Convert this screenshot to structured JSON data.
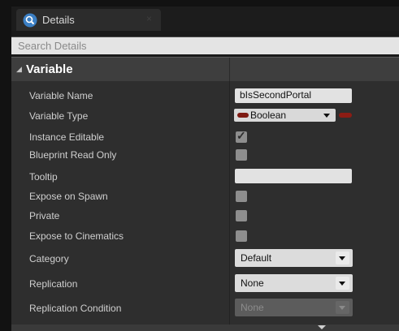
{
  "tab": {
    "title": "Details",
    "icon": "details-magnifier-icon",
    "close_icon": "close-icon"
  },
  "search": {
    "placeholder": "Search Details",
    "value": ""
  },
  "section": {
    "title": "Variable",
    "expanded": true
  },
  "properties": {
    "variable_name": {
      "label": "Variable Name",
      "value": "bIsSecondPortal"
    },
    "variable_type": {
      "label": "Variable Type",
      "value": "Boolean",
      "pin_color": "#8c1c14"
    },
    "instance_editable": {
      "label": "Instance Editable",
      "checked": true
    },
    "blueprint_read_only": {
      "label": "Blueprint Read Only",
      "checked": false
    },
    "tooltip": {
      "label": "Tooltip",
      "value": ""
    },
    "expose_on_spawn": {
      "label": "Expose on Spawn",
      "checked": false
    },
    "private": {
      "label": "Private",
      "checked": false
    },
    "expose_to_cinematics": {
      "label": "Expose to Cinematics",
      "checked": false
    },
    "category": {
      "label": "Category",
      "value": "Default"
    },
    "replication": {
      "label": "Replication",
      "value": "None"
    },
    "replication_condition": {
      "label": "Replication Condition",
      "value": "None",
      "enabled": false
    }
  },
  "colors": {
    "panel_bg": "#2e2e2e",
    "header_bg": "#3e3e3e",
    "search_bg": "#e4e4e4",
    "boolean_pin": "#8c1c14"
  },
  "icons": {
    "checkmark": "✓",
    "section_arrow": "◢"
  }
}
